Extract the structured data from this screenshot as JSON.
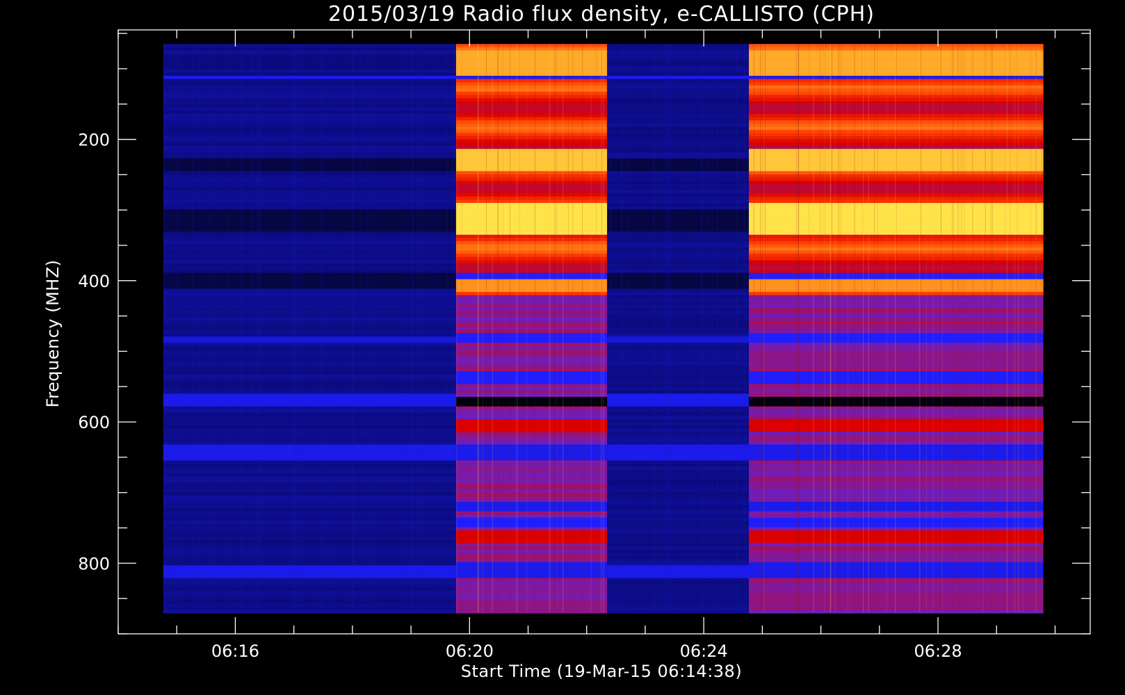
{
  "chart_data": {
    "type": "heatmap",
    "title": "2015/03/19  Radio flux density, e-CALLISTO (CPH)",
    "xlabel": "Start Time (19-Mar-15 06:14:38)",
    "ylabel": "Frequency (MHZ)",
    "x_unit": "minutes after 06:00",
    "x_range": [
      14.0,
      30.6
    ],
    "y_range": [
      45,
      900
    ],
    "y_inverted": true,
    "data_extent": {
      "x": [
        14.77,
        29.8
      ],
      "y": [
        65,
        870
      ]
    },
    "x_ticks": [
      {
        "value": 16,
        "label": "06:16"
      },
      {
        "value": 20,
        "label": "06:20"
      },
      {
        "value": 24,
        "label": "06:24"
      },
      {
        "value": 28,
        "label": "06:28"
      }
    ],
    "x_minor_step": 1,
    "y_ticks": [
      {
        "value": 200,
        "label": "200"
      },
      {
        "value": 400,
        "label": "400"
      },
      {
        "value": 600,
        "label": "600"
      },
      {
        "value": 800,
        "label": "800"
      }
    ],
    "y_minor_step": 50,
    "colormap": "black-blue-purple-red-orange-yellow",
    "segments": [
      {
        "x_start": 14.77,
        "x_end": 19.77,
        "state": "quiet"
      },
      {
        "x_start": 19.77,
        "x_end": 22.35,
        "state": "active"
      },
      {
        "x_start": 22.35,
        "x_end": 24.77,
        "state": "quiet"
      },
      {
        "x_start": 24.77,
        "x_end": 29.8,
        "state": "active"
      }
    ]
  }
}
